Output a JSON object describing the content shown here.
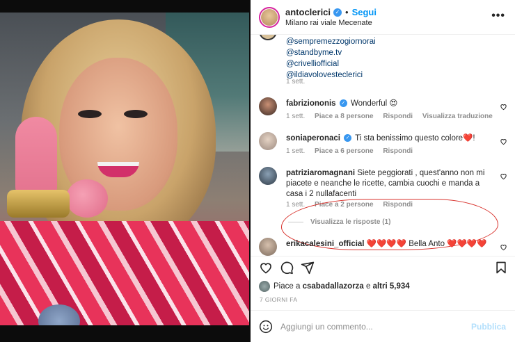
{
  "post": {
    "username": "antoclerici",
    "follow_label": "Segui",
    "location": "Milano rai viale Mecenate",
    "more_label": "•••"
  },
  "mentions": [
    "@sempremezzogiornorai",
    "@standbyme.tv",
    "@crivelliofficial",
    "@ildiavolovesteclerici"
  ],
  "caption_time": "1 sett.",
  "comments": [
    {
      "user": "fabriziononis",
      "verified": true,
      "text": "Wonderful 😍",
      "time": "1 sett.",
      "likes": "Piace a 8 persone",
      "reply": "Rispondi",
      "translate": "Visualizza traduzione"
    },
    {
      "user": "soniaperonaci",
      "verified": true,
      "text": "Ti sta benissimo questo colore❤️!",
      "time": "1 sett.",
      "likes": "Piace a 6 persone",
      "reply": "Rispondi"
    },
    {
      "user": "patriziaromagnani",
      "verified": false,
      "text": "Siete peggiorati , quest'anno non mi piacete e neanche le ricette, cambia cuochi e manda a casa i 2 nullafacenti",
      "time": "1 sett.",
      "likes": "Piace a 2 persone",
      "reply": "Rispondi"
    },
    {
      "user": "erikacalesini_official",
      "verified": false,
      "text": "❤️❤️❤️❤️ Bella Anto ❤️❤️❤️❤️"
    }
  ],
  "view_replies": "Visualizza le risposte (1)",
  "likes_prefix": "Piace a",
  "likes_user": "csabadallazorza",
  "likes_and": "e",
  "likes_others": "altri 5,934",
  "posted_ago": "7 GIORNI FA",
  "comment_placeholder": "Aggiungi un commento...",
  "publish_label": "Pubblica",
  "icons": [
    "heart-icon",
    "comment-icon",
    "share-icon",
    "bookmark-icon",
    "emoji-icon",
    "verified-icon",
    "more-icon"
  ],
  "colors": {
    "accent": "#0095f6",
    "verified": "#3897f0",
    "annotation": "#d8312b",
    "muted": "#8e8e8e"
  }
}
